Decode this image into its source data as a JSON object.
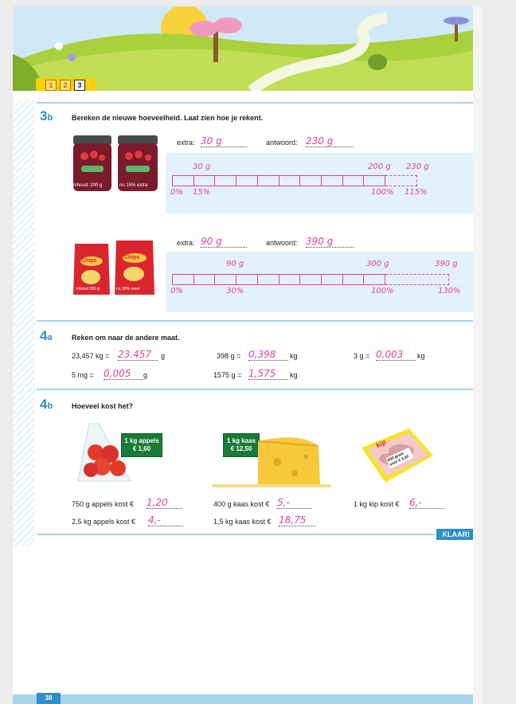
{
  "levels": [
    "1",
    "2",
    "3"
  ],
  "s3b": {
    "number": "3",
    "letter": "b",
    "title": "Bereken de nieuwe hoeveelheid. Laat zien hoe je rekent.",
    "jam": {
      "extra_label": "extra:",
      "extra": "30 g",
      "answer_label": "antwoord:",
      "answer": "230 g",
      "jar1_label": "inhoud: 200 g",
      "jar2_label": "nu 15% extra",
      "top_left": "30 g",
      "top_mid": "200 g",
      "top_right": "230 g",
      "bottom_0": "0%",
      "bottom_1": "15%",
      "bottom_2": "100%",
      "bottom_3": "115%"
    },
    "chips": {
      "extra_label": "extra:",
      "extra": "90 g",
      "answer_label": "antwoord:",
      "answer": "390 g",
      "bag1_brand": "Chips",
      "bag2_brand": "Chips",
      "bag1_label": "inhoud 300 g",
      "bag2_label": "nu 30% meer",
      "top_left": "90 g",
      "top_mid": "300 g",
      "top_right": "390 g",
      "bottom_0": "0%",
      "bottom_1": "30%",
      "bottom_2": "100%",
      "bottom_3": "130%"
    }
  },
  "s4a": {
    "number": "4",
    "letter": "a",
    "title": "Reken om naar de andere maat.",
    "items": [
      {
        "pre": "23,457 kg =",
        "ans": "23.457",
        "unit": "g"
      },
      {
        "pre": "398 g =",
        "ans": "0,398",
        "unit": "kg"
      },
      {
        "pre": "3 g =",
        "ans": "0,003",
        "unit": "kg"
      },
      {
        "pre": "5 mg =",
        "ans": "0,005",
        "unit": "g"
      },
      {
        "pre": "1575 g =",
        "ans": "1,575",
        "unit": "kg"
      }
    ]
  },
  "s4b": {
    "number": "4",
    "letter": "b",
    "title": "Hoeveel kost het?",
    "sign_apples": [
      "1 kg appels",
      "€ 1,60"
    ],
    "sign_cheese": [
      "1 kg kaas",
      "€ 12,50"
    ],
    "kip_label": "kip",
    "kip_sticker": "600 gram voor € 3,60",
    "items": [
      {
        "pre": "750 g appels kost €",
        "ans": "1,20"
      },
      {
        "pre": "400 g kaas kost €",
        "ans": "5,-"
      },
      {
        "pre": "1 kg kip kost €",
        "ans": "6,-"
      },
      {
        "pre": "2,5 kg appels kost €",
        "ans": "4,-"
      },
      {
        "pre": "1,5 kg kaas kost €",
        "ans": "18,75"
      }
    ]
  },
  "klaar": "KLAAR!",
  "page_number": "38",
  "colors": {
    "accent": "#2e8ec8",
    "answer": "#e0409a",
    "band": "#e3f1fa",
    "rule": "#a8d3ea"
  }
}
